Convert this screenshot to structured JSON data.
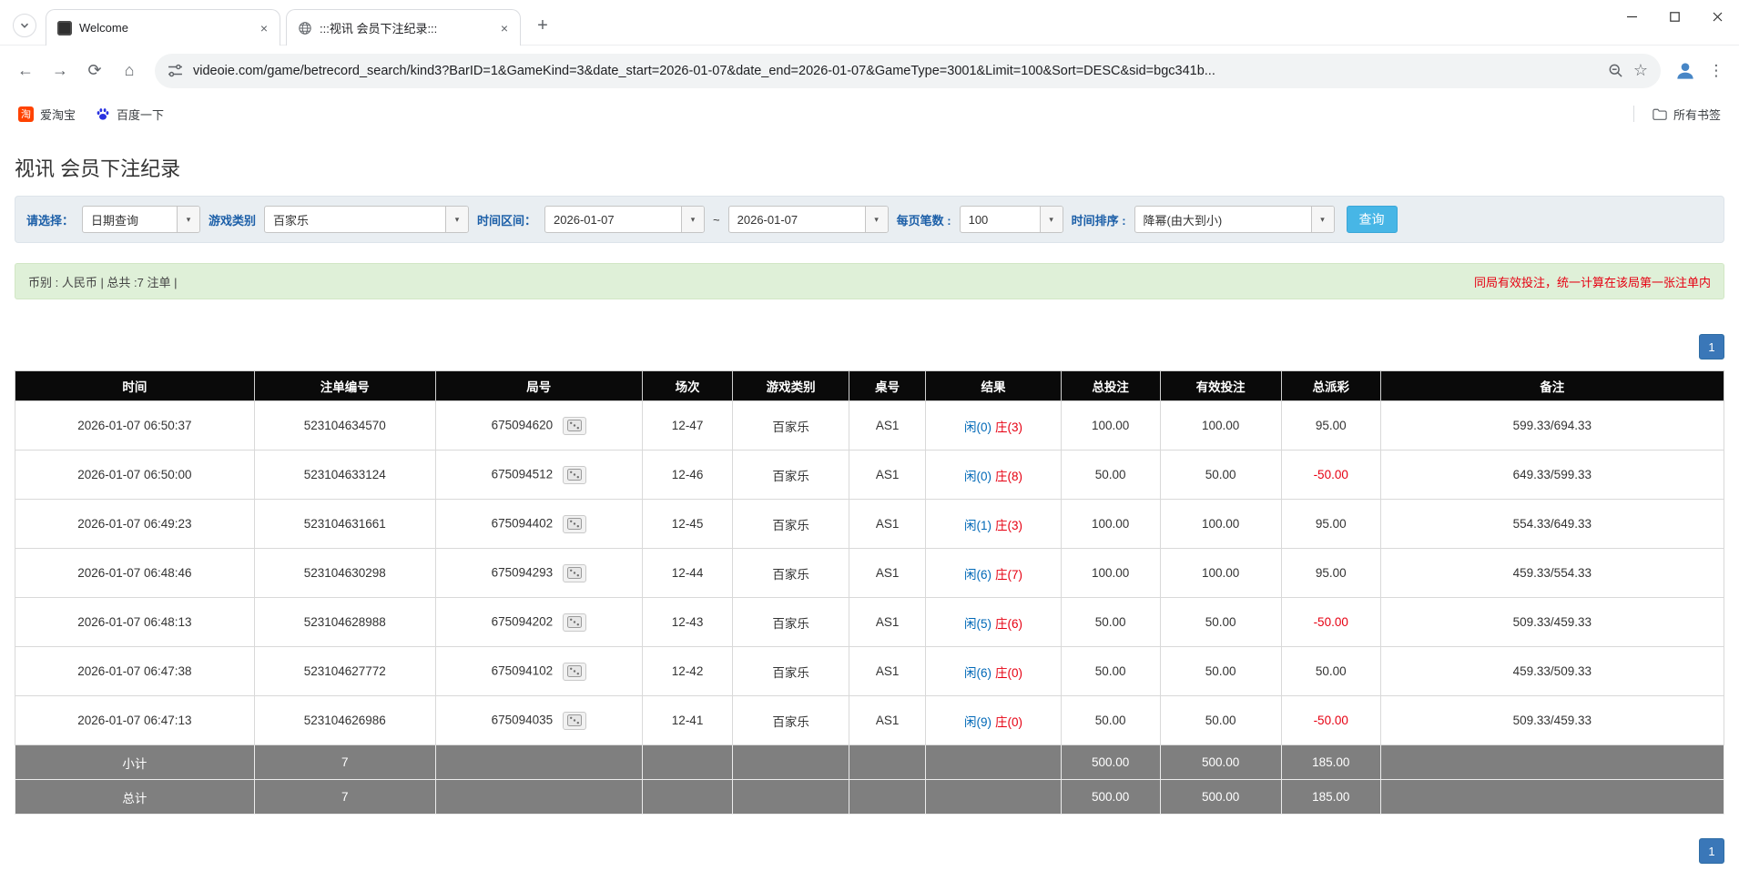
{
  "icons": {
    "tab_close": "×",
    "new_tab": "+",
    "back": "←",
    "forward": "→",
    "refresh": "⟳",
    "home": "⌂",
    "bookmark_star": "☆",
    "menu": "⋮",
    "combo_chevron": "▾",
    "taobao_glyph": "淘"
  },
  "browser": {
    "tabs": [
      {
        "title": "Welcome"
      },
      {
        "title": ":::视讯 会员下注纪录:::"
      }
    ],
    "url": "videoie.com/game/betrecord_search/kind3?BarID=1&GameKind=3&date_start=2026-01-07&date_end=2026-01-07&GameType=3001&Limit=100&Sort=DESC&sid=bgc341b...",
    "bookmarks": {
      "items": [
        {
          "label": "爱淘宝"
        },
        {
          "label": "百度一下"
        }
      ],
      "all_bookmarks": "所有书签"
    }
  },
  "page": {
    "title": "视讯 会员下注纪录",
    "filters": {
      "select_label": "请选择：",
      "select_value": "日期查询",
      "game_kind_label": "游戏类别",
      "game_kind_value": "百家乐",
      "range_label": "时间区间：",
      "date_start": "2026-01-07",
      "range_separator": "~",
      "date_end": "2026-01-07",
      "per_page_label": "每页笔数 :",
      "per_page_value": "100",
      "sort_label": "时间排序 :",
      "sort_value": "降幂(由大到小)",
      "search_button": "查询"
    },
    "info_bar": {
      "summary": "币别 : 人民币 | 总共 :7 注单 |",
      "notice": "同局有效投注，统一计算在该局第一张注单内"
    },
    "pagination": {
      "page": "1"
    },
    "table": {
      "headers": [
        "时间",
        "注单编号",
        "局号",
        "场次",
        "游戏类别",
        "桌号",
        "结果",
        "总投注",
        "有效投注",
        "总派彩",
        "备注"
      ],
      "rows": [
        {
          "time": "2026-01-07 06:50:37",
          "bet_id": "523104634570",
          "round_id": "675094620",
          "session": "12-47",
          "game": "百家乐",
          "table_no": "AS1",
          "player": "闲(0)",
          "banker": "庄(3)",
          "total_bet": "100.00",
          "valid_bet": "100.00",
          "payout": "95.00",
          "note": "599.33/694.33"
        },
        {
          "time": "2026-01-07 06:50:00",
          "bet_id": "523104633124",
          "round_id": "675094512",
          "session": "12-46",
          "game": "百家乐",
          "table_no": "AS1",
          "player": "闲(0)",
          "banker": "庄(8)",
          "total_bet": "50.00",
          "valid_bet": "50.00",
          "payout": "-50.00",
          "note": "649.33/599.33"
        },
        {
          "time": "2026-01-07 06:49:23",
          "bet_id": "523104631661",
          "round_id": "675094402",
          "session": "12-45",
          "game": "百家乐",
          "table_no": "AS1",
          "player": "闲(1)",
          "banker": "庄(3)",
          "total_bet": "100.00",
          "valid_bet": "100.00",
          "payout": "95.00",
          "note": "554.33/649.33"
        },
        {
          "time": "2026-01-07 06:48:46",
          "bet_id": "523104630298",
          "round_id": "675094293",
          "session": "12-44",
          "game": "百家乐",
          "table_no": "AS1",
          "player": "闲(6)",
          "banker": "庄(7)",
          "total_bet": "100.00",
          "valid_bet": "100.00",
          "payout": "95.00",
          "note": "459.33/554.33"
        },
        {
          "time": "2026-01-07 06:48:13",
          "bet_id": "523104628988",
          "round_id": "675094202",
          "session": "12-43",
          "game": "百家乐",
          "table_no": "AS1",
          "player": "闲(5)",
          "banker": "庄(6)",
          "total_bet": "50.00",
          "valid_bet": "50.00",
          "payout": "-50.00",
          "note": "509.33/459.33"
        },
        {
          "time": "2026-01-07 06:47:38",
          "bet_id": "523104627772",
          "round_id": "675094102",
          "session": "12-42",
          "game": "百家乐",
          "table_no": "AS1",
          "player": "闲(6)",
          "banker": "庄(0)",
          "total_bet": "50.00",
          "valid_bet": "50.00",
          "payout": "50.00",
          "note": "459.33/509.33"
        },
        {
          "time": "2026-01-07 06:47:13",
          "bet_id": "523104626986",
          "round_id": "675094035",
          "session": "12-41",
          "game": "百家乐",
          "table_no": "AS1",
          "player": "闲(9)",
          "banker": "庄(0)",
          "total_bet": "50.00",
          "valid_bet": "50.00",
          "payout": "-50.00",
          "note": "509.33/459.33"
        }
      ],
      "subtotal": {
        "label": "小计",
        "count": "7",
        "total_bet": "500.00",
        "valid_bet": "500.00",
        "payout": "185.00"
      },
      "total": {
        "label": "总计",
        "count": "7",
        "total_bet": "500.00",
        "valid_bet": "500.00",
        "payout": "185.00"
      }
    },
    "colors": {
      "player_blue": "#0068b7",
      "banker_red": "#e60012",
      "bet_link_blue": "#0068b7",
      "negative_red": "#e60012",
      "accent_button": "#47b6e6",
      "pager_blue": "#3a77b8"
    }
  }
}
